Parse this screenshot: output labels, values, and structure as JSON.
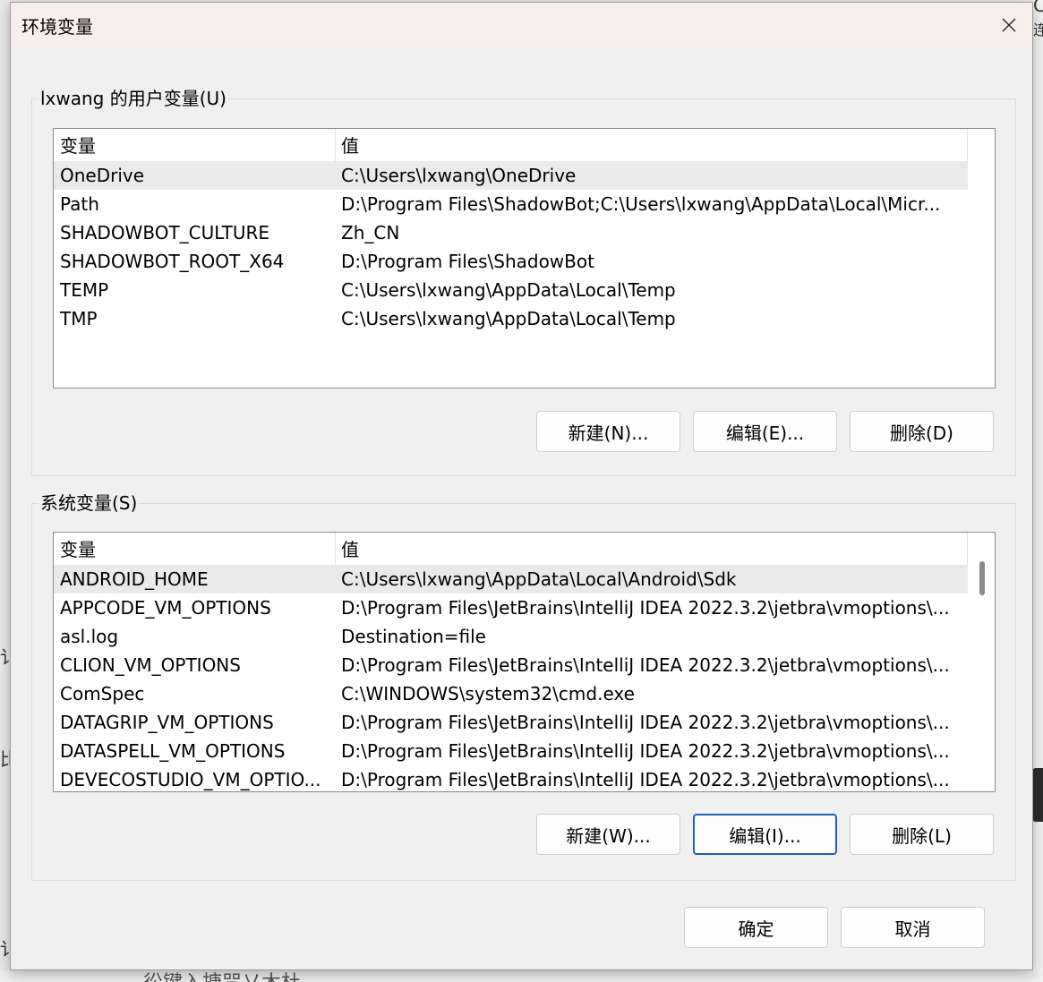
{
  "window": {
    "title": "环境变量",
    "close_label": "✕"
  },
  "user_vars": {
    "legend": "lxwang 的用户变量(U)",
    "col_name": "变量",
    "col_value": "值",
    "rows": [
      {
        "name": "OneDrive",
        "value": "C:\\Users\\lxwang\\OneDrive",
        "selected": true
      },
      {
        "name": "Path",
        "value": "D:\\Program Files\\ShadowBot;C:\\Users\\lxwang\\AppData\\Local\\Micr..."
      },
      {
        "name": "SHADOWBOT_CULTURE",
        "value": "Zh_CN"
      },
      {
        "name": "SHADOWBOT_ROOT_X64",
        "value": "D:\\Program Files\\ShadowBot"
      },
      {
        "name": "TEMP",
        "value": "C:\\Users\\lxwang\\AppData\\Local\\Temp"
      },
      {
        "name": "TMP",
        "value": "C:\\Users\\lxwang\\AppData\\Local\\Temp"
      }
    ],
    "buttons": {
      "new": "新建(N)...",
      "edit": "编辑(E)...",
      "delete": "删除(D)"
    }
  },
  "system_vars": {
    "legend": "系统变量(S)",
    "col_name": "变量",
    "col_value": "值",
    "rows": [
      {
        "name": "ANDROID_HOME",
        "value": "C:\\Users\\lxwang\\AppData\\Local\\Android\\Sdk",
        "selected": true
      },
      {
        "name": "APPCODE_VM_OPTIONS",
        "value": "D:\\Program Files\\JetBrains\\IntelliJ IDEA 2022.3.2\\jetbra\\vmoptions\\..."
      },
      {
        "name": "asl.log",
        "value": "Destination=file"
      },
      {
        "name": "CLION_VM_OPTIONS",
        "value": "D:\\Program Files\\JetBrains\\IntelliJ IDEA 2022.3.2\\jetbra\\vmoptions\\..."
      },
      {
        "name": "ComSpec",
        "value": "C:\\WINDOWS\\system32\\cmd.exe"
      },
      {
        "name": "DATAGRIP_VM_OPTIONS",
        "value": "D:\\Program Files\\JetBrains\\IntelliJ IDEA 2022.3.2\\jetbra\\vmoptions\\..."
      },
      {
        "name": "DATASPELL_VM_OPTIONS",
        "value": "D:\\Program Files\\JetBrains\\IntelliJ IDEA 2022.3.2\\jetbra\\vmoptions\\..."
      },
      {
        "name": "DEVECOSTUDIO_VM_OPTIO...",
        "value": "D:\\Program Files\\JetBrains\\IntelliJ IDEA 2022.3.2\\jetbra\\vmoptions\\..."
      }
    ],
    "buttons": {
      "new": "新建(W)...",
      "edit": "编辑(I)...",
      "delete": "删除(L)"
    }
  },
  "footer": {
    "ok": "确定",
    "cancel": "取消"
  },
  "background": {
    "text_bottom": "彸键入搪咒乂木杜",
    "glyph_left_1": "讠",
    "glyph_left_2": "比",
    "glyph_left_3": "讠",
    "glyph_right_1": "C",
    "glyph_right_2": "连"
  }
}
